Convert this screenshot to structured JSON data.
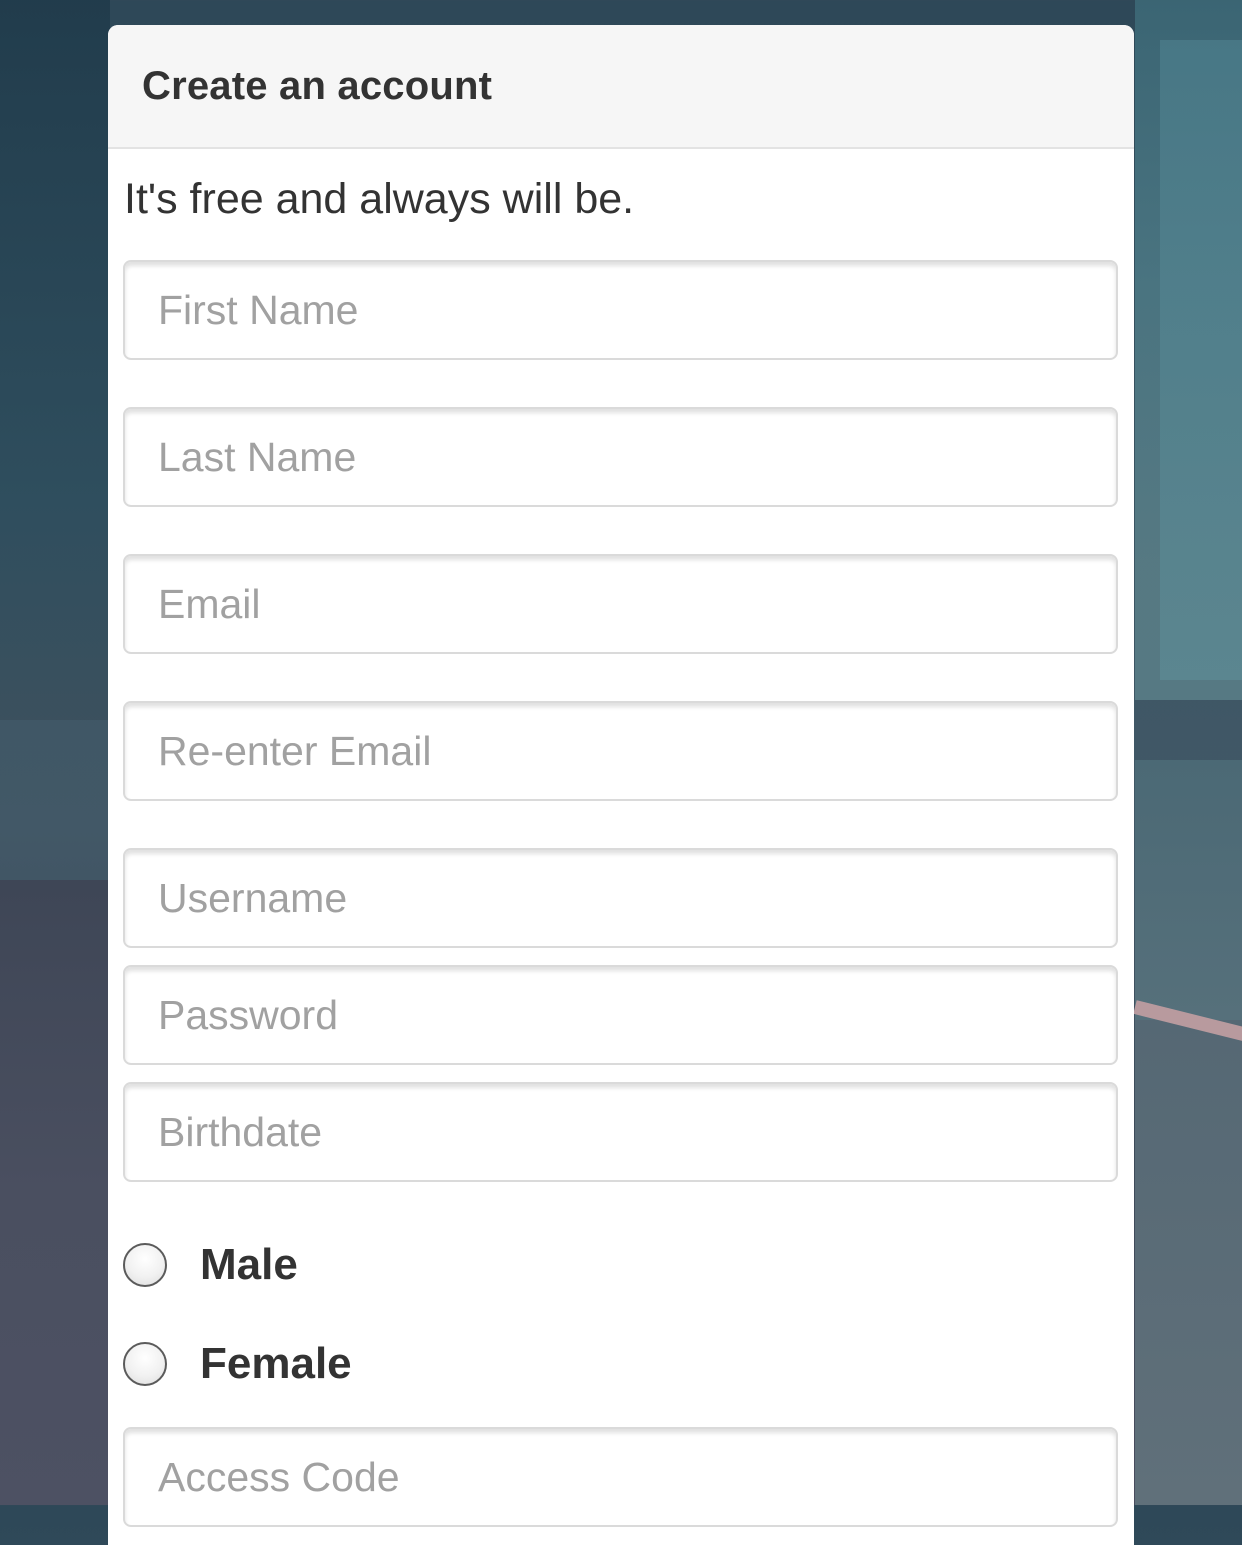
{
  "form": {
    "title": "Create an account",
    "tagline": "It's free and always will be.",
    "fields": {
      "first_name": {
        "placeholder": "First Name",
        "value": ""
      },
      "last_name": {
        "placeholder": "Last Name",
        "value": ""
      },
      "email": {
        "placeholder": "Email",
        "value": ""
      },
      "reenter_email": {
        "placeholder": "Re-enter Email",
        "value": ""
      },
      "username": {
        "placeholder": "Username",
        "value": ""
      },
      "password": {
        "placeholder": "Password",
        "value": ""
      },
      "birthdate": {
        "placeholder": "Birthdate",
        "value": ""
      },
      "access_code": {
        "placeholder": "Access Code",
        "value": ""
      }
    },
    "gender": {
      "options": [
        {
          "label": "Male",
          "selected": false
        },
        {
          "label": "Female",
          "selected": false
        }
      ]
    }
  },
  "colors": {
    "text": "#333333",
    "placeholder": "#a1a1a1",
    "header_bg": "#f6f6f6",
    "field_border": "#dadada"
  }
}
